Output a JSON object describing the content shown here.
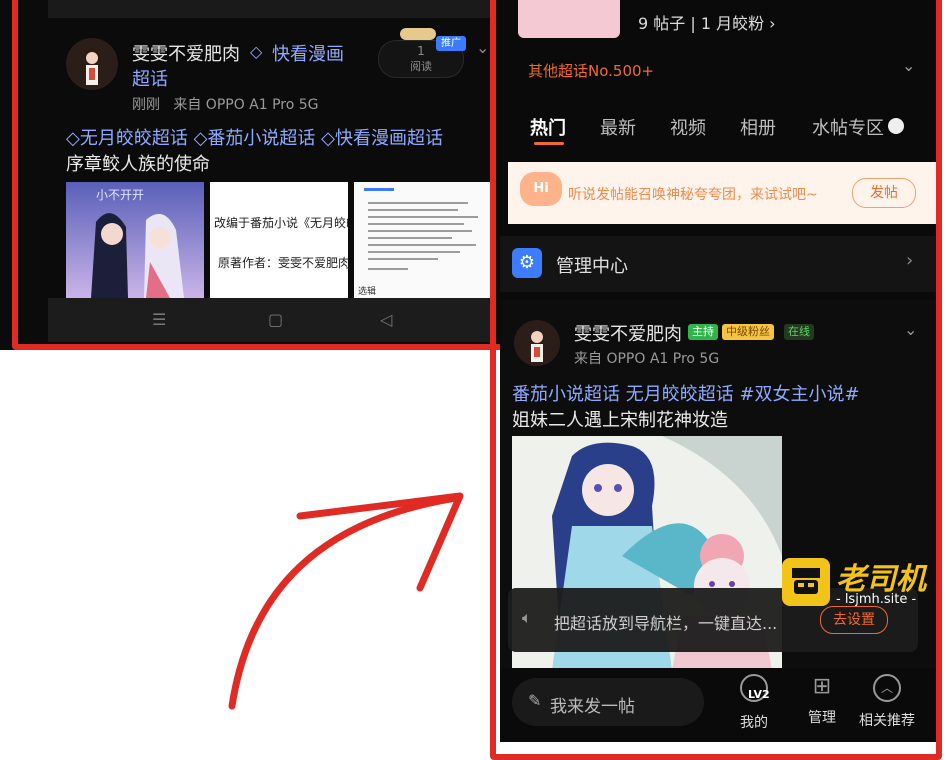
{
  "left_post": {
    "username": "雯雯不爱肥肉",
    "community": "快看漫画",
    "community_line2": "超话",
    "read_count": "1",
    "read_label": "阅读",
    "promo_badge": "推广",
    "meta": "刚刚   来自 OPPO A1 Pro 5G",
    "tags": [
      "无月皎皎超话",
      "番茄小说超话",
      "快看漫画超话"
    ],
    "title": "序章鲛人族的使命",
    "thumb1_caption": "小不开开",
    "thumb2_line1": "改编于番茄小说《无月皎皎》",
    "thumb2_line2": "原著作者：雯雯不爱肥肉",
    "thumb3_footer": "选辑"
  },
  "right_page": {
    "stats": "9 帖子 | 1 月皎粉 ›",
    "other": "其他超话No.500+",
    "tabs": [
      "热门",
      "最新",
      "视频",
      "相册",
      "水帖专区"
    ],
    "banner_text": "听说发帖能召唤神秘夸夸团，来试试吧~",
    "banner_button": "发帖",
    "management": "管理中心",
    "post": {
      "username": "雯雯不爱肥肉",
      "badge_host": "主持",
      "badge_level": "中级粉丝",
      "badge_online": "在线",
      "device": "来自 OPPO A1 Pro 5G",
      "tags": "番茄小说超话  无月皎皎超话  #双女主小说#",
      "title": "姐妹二人遇上宋制花神妆造"
    },
    "toast_text": "把超话放到导航栏，一键直达...",
    "toast_button": "去设置",
    "compose": "我来发一帖",
    "nav": {
      "mine": "我的",
      "level": "LV2",
      "manage": "管理",
      "recommend": "相关推荐"
    }
  },
  "watermark": {
    "title": "老司机",
    "url": "- lsjmh.site -"
  },
  "colors": {
    "red_mark": "#e02a24",
    "orange": "#f06a2c",
    "chaohua_blue": "#8fa9ff"
  }
}
